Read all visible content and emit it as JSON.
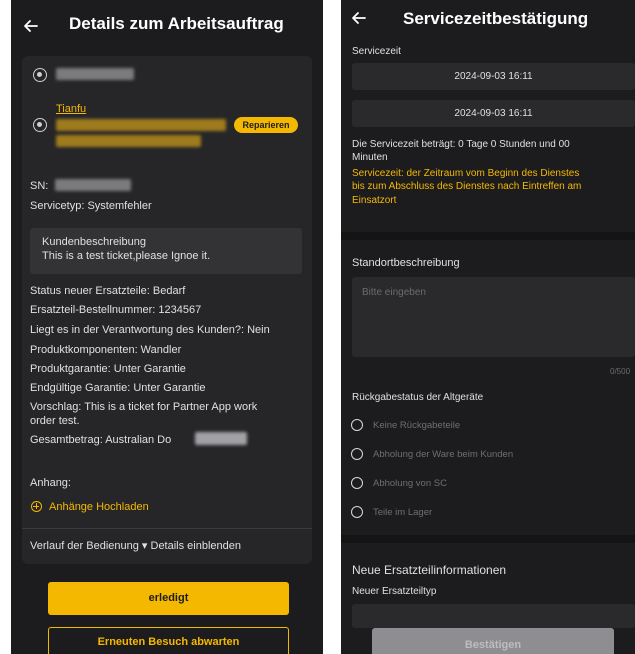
{
  "left": {
    "header": {
      "title": "Details zum Arbeitsauftrag"
    },
    "contact": {
      "name": "Tianfu"
    },
    "repair_label": "Reparieren",
    "sn_label": "SN:",
    "service_type": "Servicetyp:  Systemfehler",
    "customer_description": {
      "title": "Kundenbeschreibung",
      "text": "This is a test ticket,please Ignoe it."
    },
    "details": [
      "Status neuer Ersatzteile:  Bedarf",
      "Ersatzteil-Bestellnummer:  1234567",
      "Liegt es in der Verantwortung des Kunden?:  Nein",
      "Produktkomponenten:  Wandler",
      "Produktgarantie:  Unter Garantie",
      "Endgültige Garantie:  Unter Garantie",
      "Vorschlag:  This is a ticket for Partner App work",
      "order test.",
      "Gesamtbetrag:  Australian Do"
    ],
    "attachment_label": "Anhang:",
    "upload_label": "Anhänge Hochladen",
    "history_label": "Verlauf der Bedienung ▾ Details einblenden",
    "done_button": "erledigt",
    "revisit_button": "Erneuten Besuch abwarten"
  },
  "right": {
    "header": {
      "title": "Servicezeitbestätigung"
    },
    "service_time_label": "Servicezeit",
    "start_time": "2024-09-03 16:11",
    "end_time": "2024-09-03 16:11",
    "duration_text_1": "Die Servicezeit beträgt: 0 Tage 0 Stunden und 00",
    "duration_text_2": "Minuten",
    "hint_lines": [
      "Servicezeit: der Zeitraum vom Beginn des Dienstes",
      "bis zum Abschluss des Dienstes nach Eintreffen am",
      "Einsatzort"
    ],
    "location_label": "Standortbeschreibung",
    "location_placeholder": "Bitte eingeben",
    "char_count": "0/500",
    "return_status_label": "Rückgabestatus der Altgeräte",
    "return_options": [
      "Keine Rückgabeteile",
      "Abholung der Ware beim Kunden",
      "Abholung von SC",
      "Teile im Lager"
    ],
    "new_parts_title": "Neue Ersatzteilinformationen",
    "new_part_type_label": "Neuer Ersatzteiltyp",
    "confirm_button": "Bestätigen"
  },
  "colors": {
    "accent": "#f5b800",
    "background": "#1c1c1e",
    "card": "#262628",
    "field": "#2a2a2c"
  },
  "icons": [
    "back-arrow-icon",
    "radio-dot-icon",
    "plus-circle-icon",
    "radio-button-icon"
  ]
}
